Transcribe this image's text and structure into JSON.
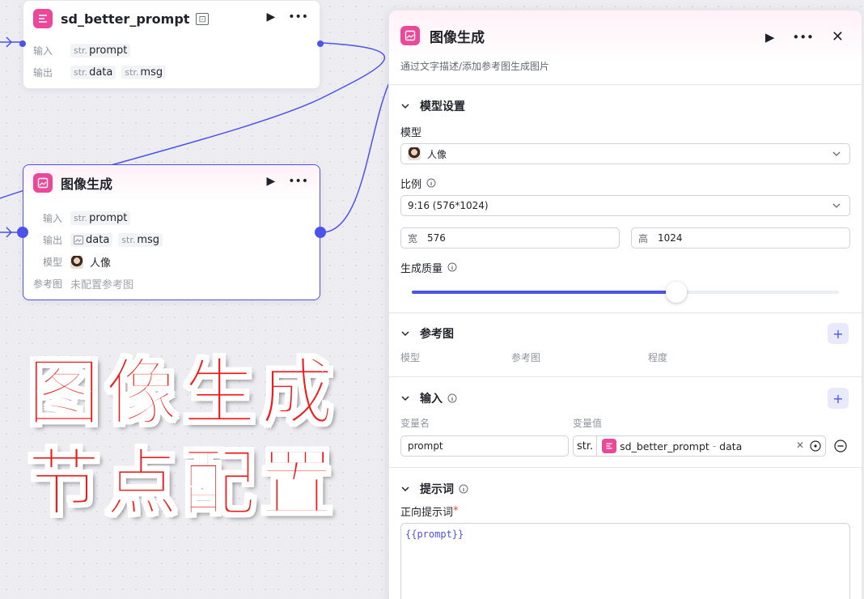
{
  "canvas": {
    "node_prompt": {
      "title": "sd_better_prompt",
      "input_label": "输入",
      "output_label": "输出",
      "inputs": [
        {
          "type": "str.",
          "name": "prompt"
        }
      ],
      "outputs": [
        {
          "type": "str.",
          "name": "data"
        },
        {
          "type": "str.",
          "name": "msg"
        }
      ]
    },
    "node_image": {
      "title": "图像生成",
      "input_label": "输入",
      "output_label": "输出",
      "model_label": "模型",
      "ref_label": "参考图",
      "inputs": [
        {
          "type": "str.",
          "name": "prompt"
        }
      ],
      "outputs": [
        {
          "type": "image",
          "name": "data"
        },
        {
          "type": "str.",
          "name": "msg"
        }
      ],
      "model_value": "人像",
      "ref_value": "未配置参考图"
    },
    "overlay_line1": "图像生成",
    "overlay_line2": "节点配置"
  },
  "panel": {
    "title": "图像生成",
    "description": "通过文字描述/添加参考图生成图片",
    "model_section": {
      "title": "模型设置",
      "model_label": "模型",
      "model_value": "人像",
      "ratio_label": "比例",
      "ratio_value": "9:16 (576*1024)",
      "width_label": "宽",
      "width_value": "576",
      "height_label": "高",
      "height_value": "1024",
      "quality_label": "生成质量",
      "quality_level": 0.62
    },
    "reference_section": {
      "title": "参考图",
      "columns": [
        "模型",
        "参考图",
        "程度"
      ]
    },
    "input_section": {
      "title": "输入",
      "col_name": "变量名",
      "col_value": "变量值",
      "var_name": "prompt",
      "ref_type": "str.",
      "ref_node": "sd_better_prompt",
      "ref_separator": "-",
      "ref_field": "data"
    },
    "prompt_section": {
      "title": "提示词",
      "positive_label": "正向提示词",
      "required_mark": "*",
      "positive_value": "{{prompt}}"
    }
  },
  "colors": {
    "accent": "#4d53e8",
    "node_icon": "#ec4899",
    "overlay_text": "#ee1c1c"
  }
}
